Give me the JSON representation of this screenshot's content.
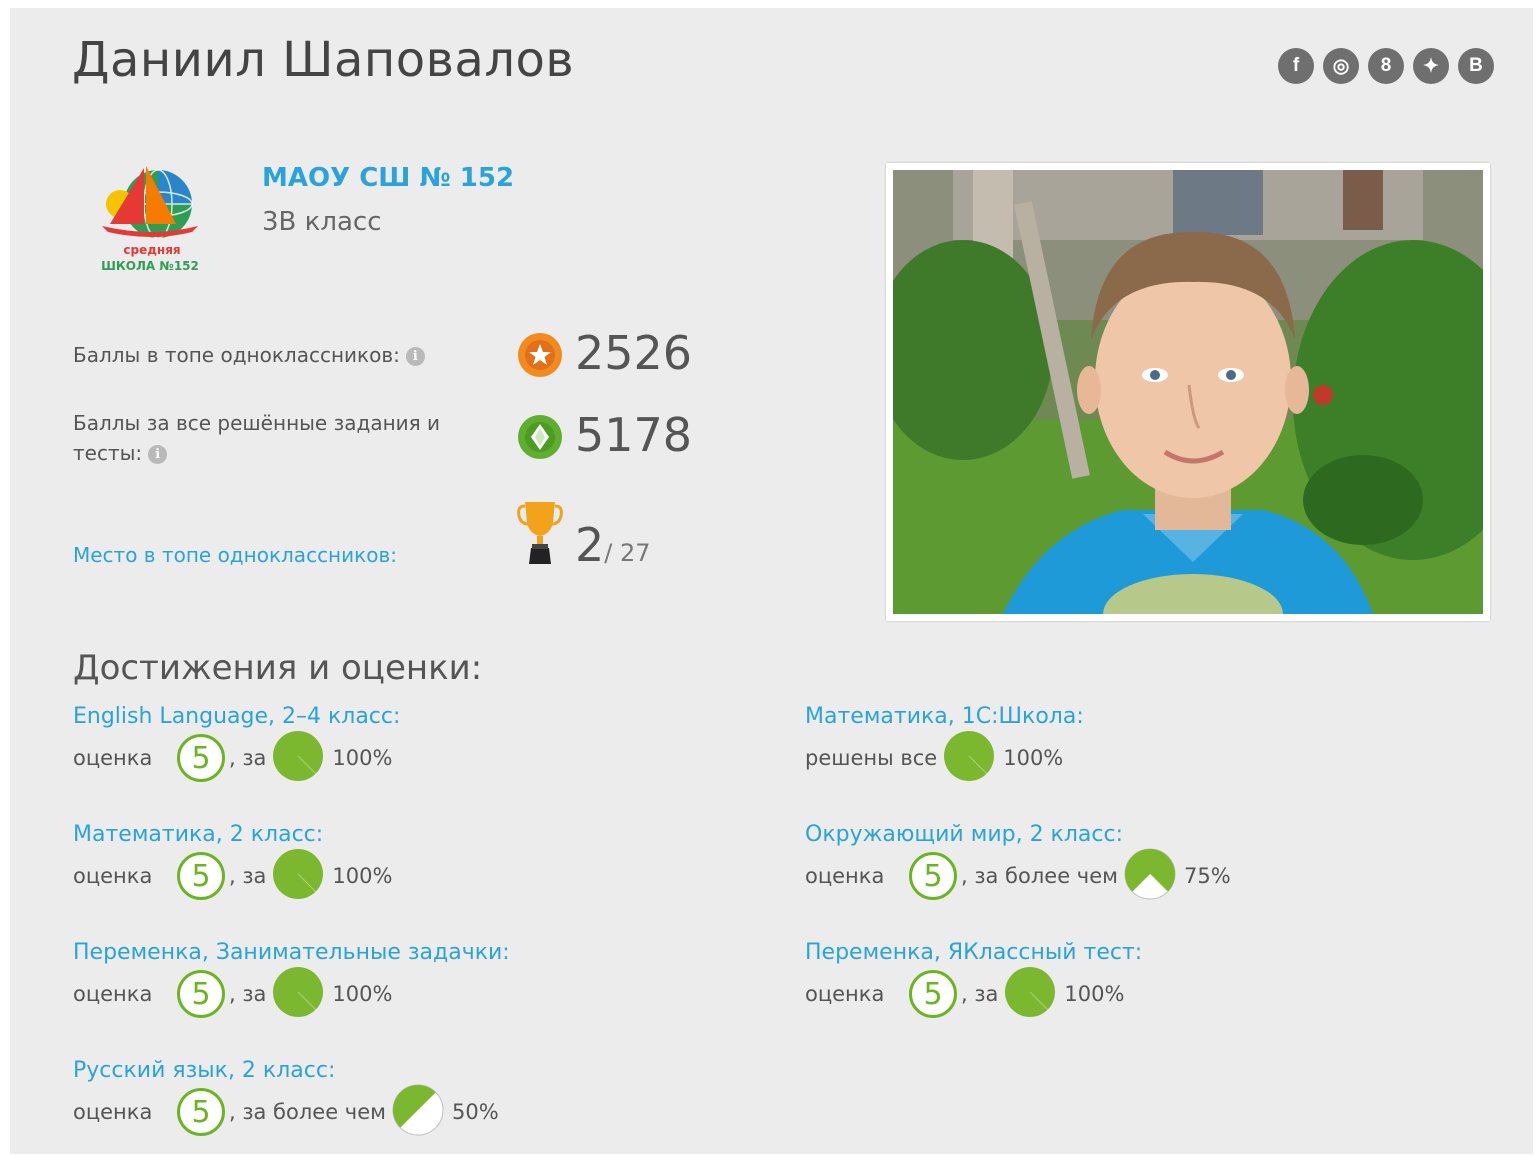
{
  "profile": {
    "name": "Даниил Шаповалов",
    "school": "МАОУ СШ № 152",
    "school_class": "3В класс",
    "logo_text_1": "средняя",
    "logo_text_2": "ШКОЛА №152"
  },
  "social": [
    {
      "name": "facebook",
      "glyph": "f"
    },
    {
      "name": "instagram",
      "glyph": "◎"
    },
    {
      "name": "odnoklassniki",
      "glyph": "8"
    },
    {
      "name": "twitter",
      "glyph": "✦"
    },
    {
      "name": "vkontakte",
      "glyph": "B"
    }
  ],
  "stats": {
    "top_points_label": "Баллы в топе одноклассников:",
    "top_points_value": "2526",
    "all_points_label": "Баллы за все решённые задания и тесты:",
    "all_points_value": "5178",
    "rank_label": "Место в топе одноклассников:",
    "rank_value": "2",
    "rank_total": "/ 27"
  },
  "achievements": {
    "title": "Достижения и оценки:",
    "items": [
      {
        "title": "English Language, 2–4 класс:",
        "label": "оценка",
        "grade": "5",
        "middle": ", за",
        "percent": 100,
        "percent_text": "100%"
      },
      {
        "title": "Математика, 2 класс:",
        "label": "оценка",
        "grade": "5",
        "middle": ", за",
        "percent": 100,
        "percent_text": "100%"
      },
      {
        "title": "Переменка, Занимательные задачки:",
        "label": "оценка",
        "grade": "5",
        "middle": ", за",
        "percent": 100,
        "percent_text": "100%"
      },
      {
        "title": "Русский язык, 2 класс:",
        "label": "оценка",
        "grade": "5",
        "middle": ", за более чем",
        "percent": 50,
        "percent_text": "50%"
      },
      {
        "title": "Математика, 1С:Школа:",
        "label": "решены все",
        "grade": "",
        "middle": "",
        "percent": 100,
        "percent_text": "100%"
      },
      {
        "title": "Окружающий мир, 2 класс:",
        "label": "оценка",
        "grade": "5",
        "middle": ", за более чем",
        "percent": 75,
        "percent_text": "75%"
      },
      {
        "title": "Переменка, ЯКлассный тест:",
        "label": "оценка",
        "grade": "5",
        "middle": ", за",
        "percent": 100,
        "percent_text": "100%"
      }
    ]
  },
  "colors": {
    "link": "#2aa3dc",
    "grade_green": "#6ab521",
    "pie_green": "#7cb82f",
    "panel_bg": "#ececec"
  }
}
